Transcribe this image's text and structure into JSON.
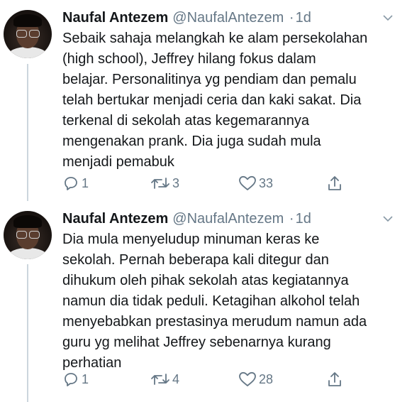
{
  "tweets": [
    {
      "author_name": "Naufal Antezem",
      "handle": "@NaufalAntezem",
      "separator": "·",
      "time": "1d",
      "text": "Sebaik sahaja melangkah ke alam persekolahan\n(high school), Jeffrey hilang fokus dalam\nbelajar. Personalitinya yg pendiam dan pemalu\ntelah bertukar menjadi ceria dan kaki sakat. Dia\nterkenal di sekolah atas kegemarannya\nmengenakan prank. Dia juga sudah mula\nmenjadi pemabuk",
      "replies": "1",
      "retweets": "3",
      "likes": "33"
    },
    {
      "author_name": "Naufal Antezem",
      "handle": "@NaufalAntezem",
      "separator": "·",
      "time": "1d",
      "text": "Dia mula menyeludup minuman keras ke\nsekolah. Pernah beberapa kali ditegur dan\ndihukum oleh pihak sekolah atas kegiatannya\nnamun dia tidak peduli. Ketagihan alkohol telah\nmenyebabkan prestasinya merudum namun ada\nguru yg melihat Jeffrey sebenarnya kurang\nperhatian",
      "replies": "1",
      "retweets": "4",
      "likes": "28"
    }
  ],
  "icons": {
    "reply": "reply-icon",
    "retweet": "retweet-icon",
    "like": "heart-icon",
    "share": "share-icon",
    "caret": "chevron-down-icon"
  },
  "colors": {
    "text": "#14171a",
    "secondary": "#657786",
    "thread_line": "#ccd6dd"
  }
}
